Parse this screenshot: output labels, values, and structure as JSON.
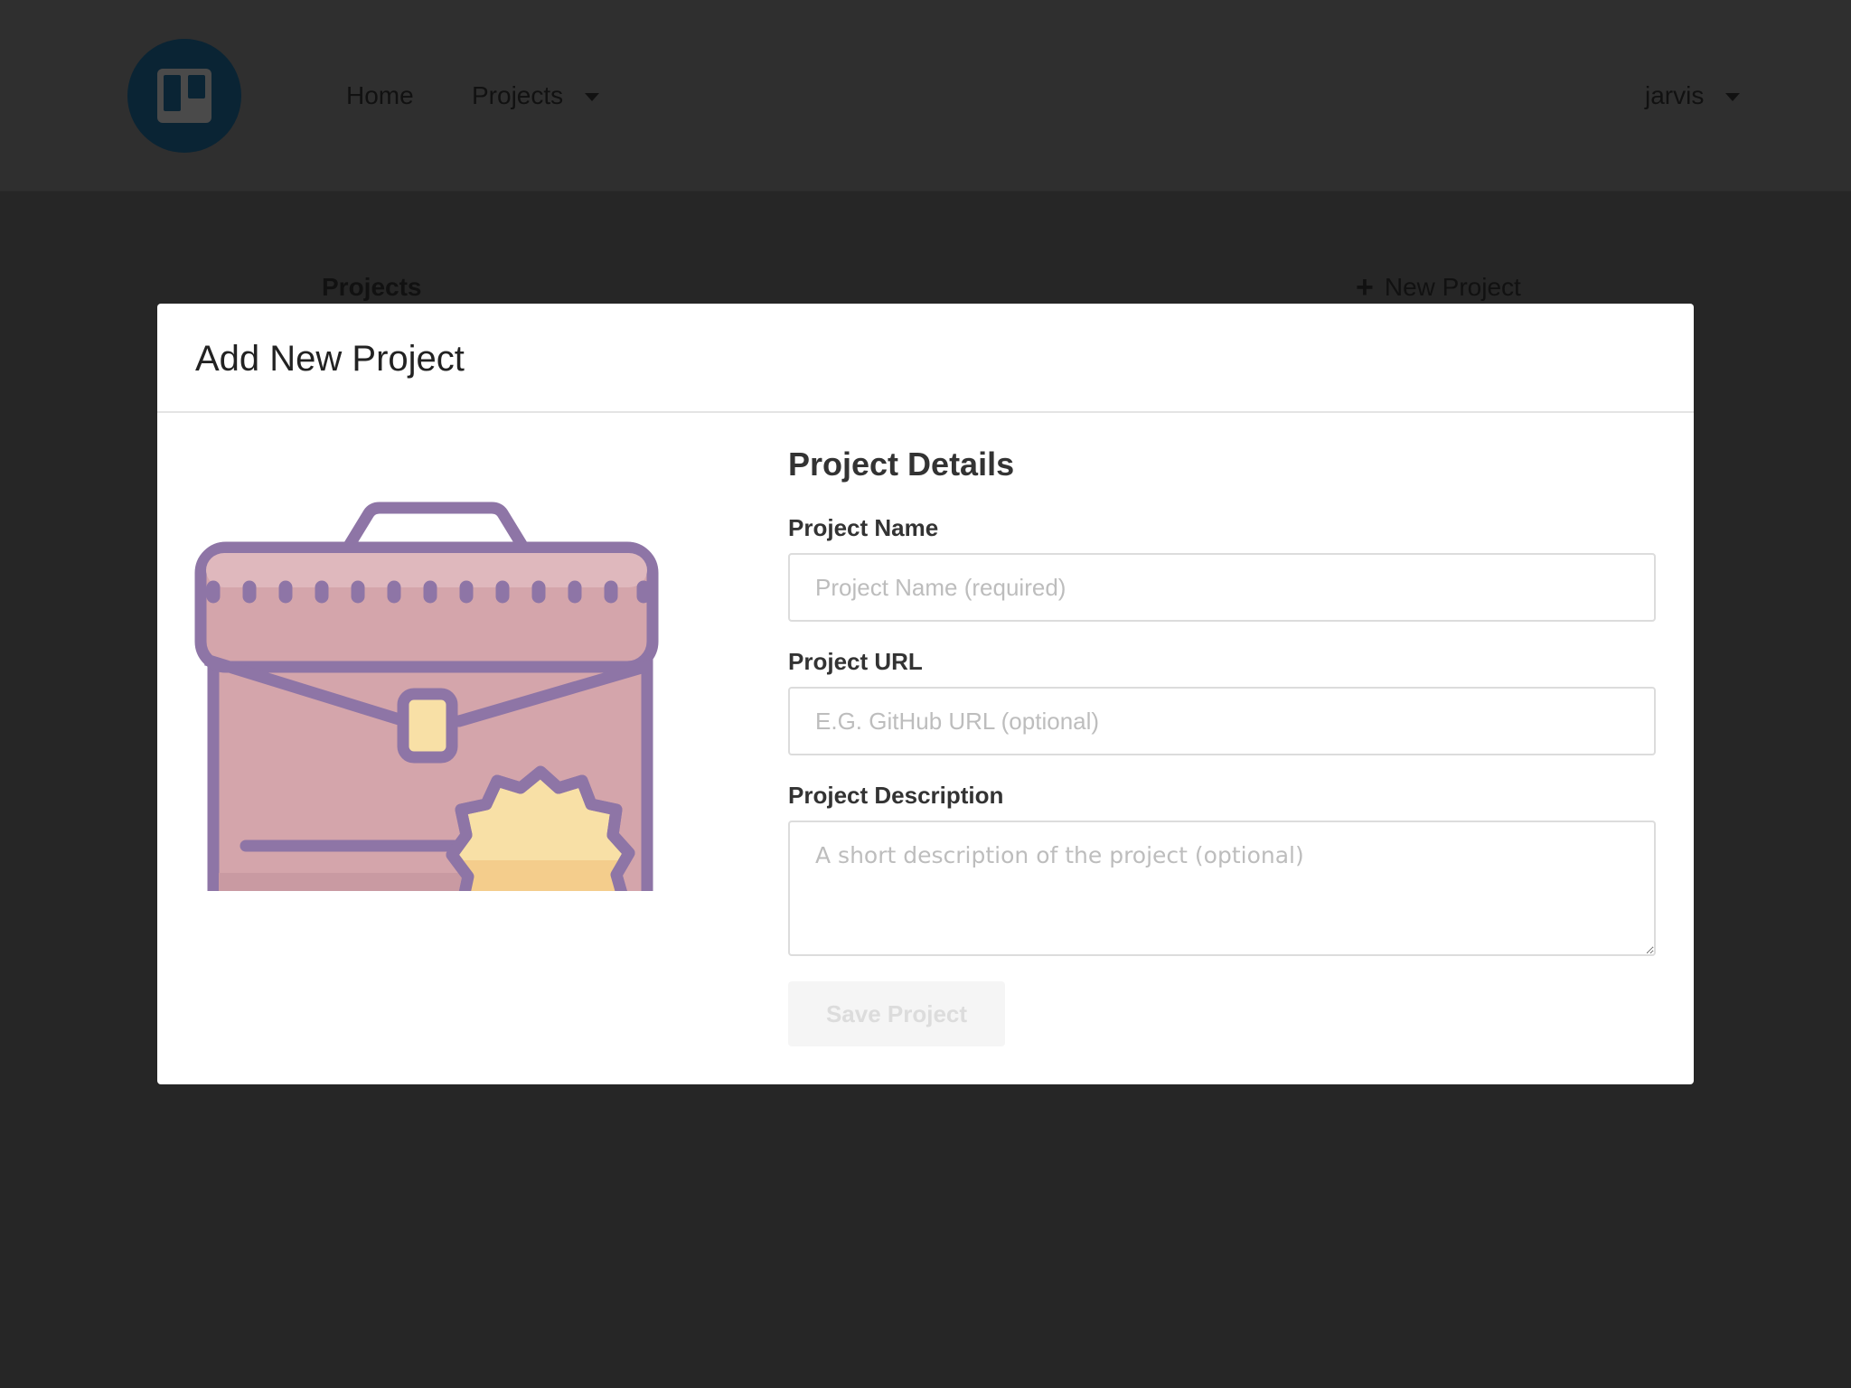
{
  "navbar": {
    "logo_icon": "board-logo-icon",
    "home_label": "Home",
    "projects_label": "Projects",
    "user_label": "jarvis"
  },
  "page": {
    "heading": "Projects",
    "new_project_label": "New Project"
  },
  "modal": {
    "title": "Add New Project",
    "illustration_icon": "briefcase-badge-icon",
    "section_title": "Project Details",
    "fields": {
      "name": {
        "label": "Project Name",
        "placeholder": "Project Name (required)",
        "value": ""
      },
      "url": {
        "label": "Project URL",
        "placeholder": "E.G. GitHub URL (optional)",
        "value": ""
      },
      "description": {
        "label": "Project Description",
        "placeholder": "A short description of the project (optional)",
        "value": ""
      }
    },
    "save_label": "Save Project",
    "save_disabled": true
  },
  "colors": {
    "overlay_bg": "#262626",
    "modal_bg": "#ffffff",
    "logo_bg": "#0a2434",
    "briefcase_stroke": "#8e75a6",
    "briefcase_fill": "#d4a5ab",
    "badge_fill": "#f8e0a6"
  }
}
